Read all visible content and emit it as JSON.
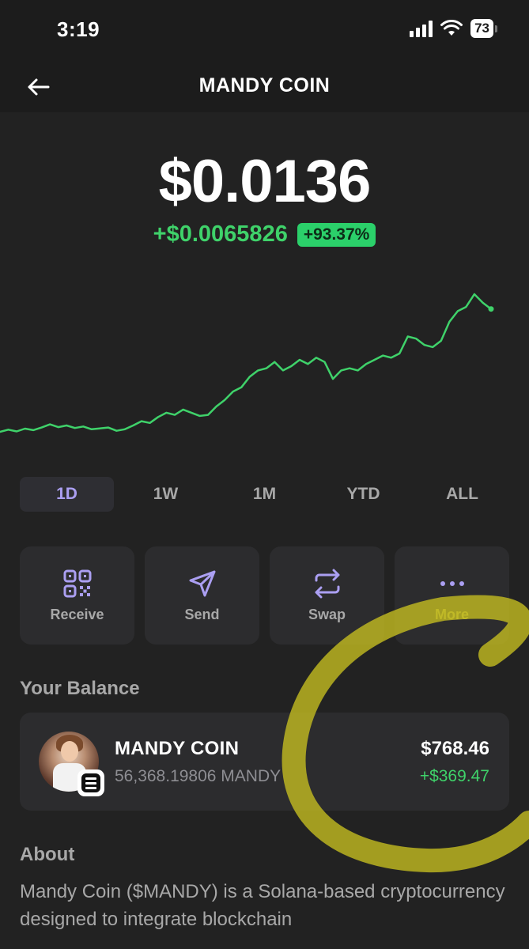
{
  "status_bar": {
    "time": "3:19",
    "battery": "73"
  },
  "header": {
    "title": "MANDY COIN"
  },
  "price": {
    "current": "$0.0136",
    "change_value": "+$0.0065826",
    "change_percent": "+93.37%"
  },
  "chart_data": {
    "type": "line",
    "title": "",
    "xlabel": "",
    "ylabel": "",
    "x": [
      0,
      1,
      2,
      3,
      4,
      5,
      6,
      7,
      8,
      9,
      10,
      11,
      12,
      13,
      14,
      15,
      16,
      17,
      18,
      19,
      20,
      21,
      22,
      23,
      24,
      25,
      26,
      27,
      28,
      29,
      30,
      31,
      32,
      33,
      34,
      35,
      36,
      37,
      38,
      39,
      40,
      41,
      42,
      43,
      44,
      45,
      46,
      47,
      48,
      49,
      50,
      51,
      52,
      53,
      54,
      55,
      56,
      57,
      58,
      59
    ],
    "values": [
      0.0071,
      0.0072,
      0.00712,
      0.00725,
      0.00718,
      0.0073,
      0.00745,
      0.00732,
      0.0074,
      0.00728,
      0.00735,
      0.00722,
      0.00726,
      0.0073,
      0.00715,
      0.00722,
      0.0074,
      0.0076,
      0.00752,
      0.0078,
      0.008,
      0.0079,
      0.00815,
      0.008,
      0.00785,
      0.0079,
      0.0083,
      0.0086,
      0.009,
      0.0092,
      0.0097,
      0.01,
      0.0101,
      0.0104,
      0.01,
      0.0102,
      0.0105,
      0.0103,
      0.0106,
      0.0104,
      0.0096,
      0.01,
      0.0101,
      0.01,
      0.0103,
      0.0105,
      0.0107,
      0.0106,
      0.0108,
      0.0116,
      0.0115,
      0.0112,
      0.0111,
      0.0114,
      0.0123,
      0.0128,
      0.013,
      0.0136,
      0.0132,
      0.0129
    ],
    "line_color": "#3fd26a",
    "grid": false,
    "legend": "none"
  },
  "range_tabs": [
    {
      "label": "1D",
      "active": true
    },
    {
      "label": "1W",
      "active": false
    },
    {
      "label": "1M",
      "active": false
    },
    {
      "label": "YTD",
      "active": false
    },
    {
      "label": "ALL",
      "active": false
    }
  ],
  "actions": [
    {
      "label": "Receive",
      "icon": "qr-code-icon"
    },
    {
      "label": "Send",
      "icon": "send-icon"
    },
    {
      "label": "Swap",
      "icon": "swap-icon"
    },
    {
      "label": "More",
      "icon": "more-icon"
    }
  ],
  "balance": {
    "section_title": "Your Balance",
    "token_name": "MANDY COIN",
    "token_amount": "56,368.19806 MANDY",
    "usd_value": "$768.46",
    "usd_change": "+$369.47"
  },
  "about": {
    "section_title": "About",
    "text": "Mandy Coin ($MANDY) is a Solana-based cryptocurrency designed to integrate blockchain"
  },
  "colors": {
    "background": "#222222",
    "accent_purple": "#ab9ff2",
    "positive_green": "#3fd26a",
    "annotation_yellow": "#c8c020"
  }
}
